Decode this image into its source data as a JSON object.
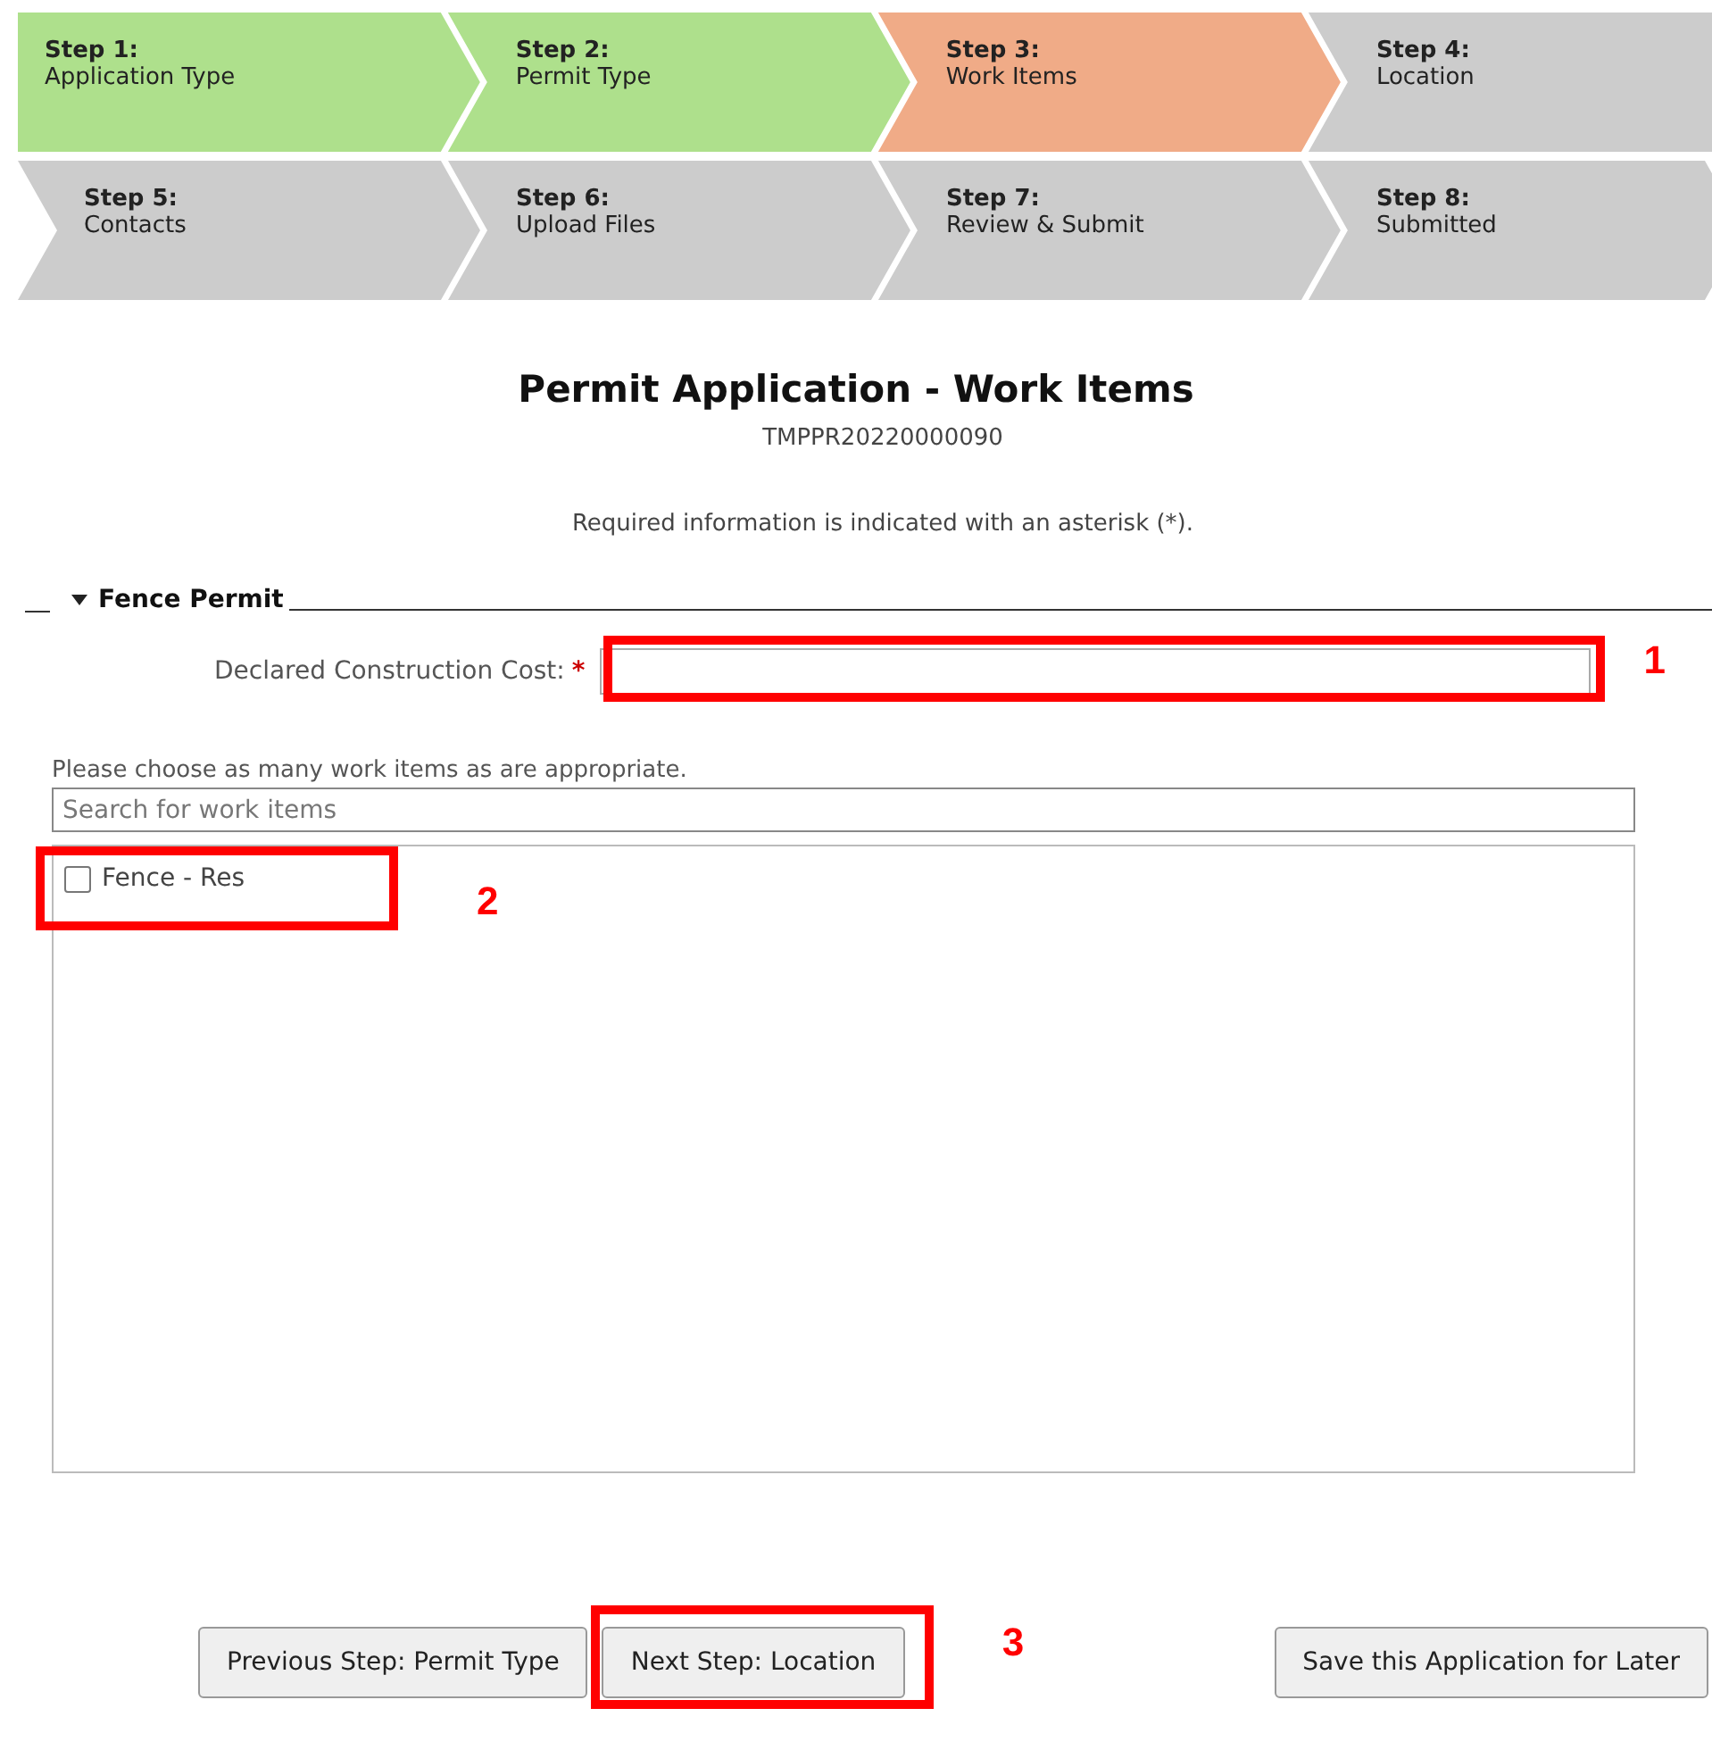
{
  "steps": [
    {
      "number": "Step 1:",
      "label": "Application Type",
      "kind": "done"
    },
    {
      "number": "Step 2:",
      "label": "Permit Type",
      "kind": "done"
    },
    {
      "number": "Step 3:",
      "label": "Work Items",
      "kind": "current"
    },
    {
      "number": "Step 4:",
      "label": "Location",
      "kind": "pending"
    },
    {
      "number": "Step 5:",
      "label": "Contacts",
      "kind": "pending"
    },
    {
      "number": "Step 6:",
      "label": "Upload Files",
      "kind": "pending"
    },
    {
      "number": "Step 7:",
      "label": "Review & Submit",
      "kind": "pending"
    },
    {
      "number": "Step 8:",
      "label": "Submitted",
      "kind": "pending"
    }
  ],
  "heading": {
    "title": "Permit Application - Work Items",
    "record_id": "TMPPR20220000090",
    "note": "Required information is indicated with an asterisk (*)."
  },
  "section": {
    "title": "Fence Permit",
    "expanded": true,
    "cost_field": {
      "label": "Declared Construction Cost:",
      "required_mark": "*",
      "annotation": "1"
    },
    "instruction": "Please choose as many work items as are appropriate.",
    "search": {
      "placeholder": "Search for work items"
    },
    "work_items": [
      {
        "label": "Fence - Res",
        "checked": false,
        "annotation": "2"
      }
    ]
  },
  "buttons": [
    {
      "label": "Previous Step: Permit Type"
    },
    {
      "label": "Next Step: Location",
      "annotation": "3"
    },
    {
      "label": "Save this Application for Later"
    }
  ]
}
